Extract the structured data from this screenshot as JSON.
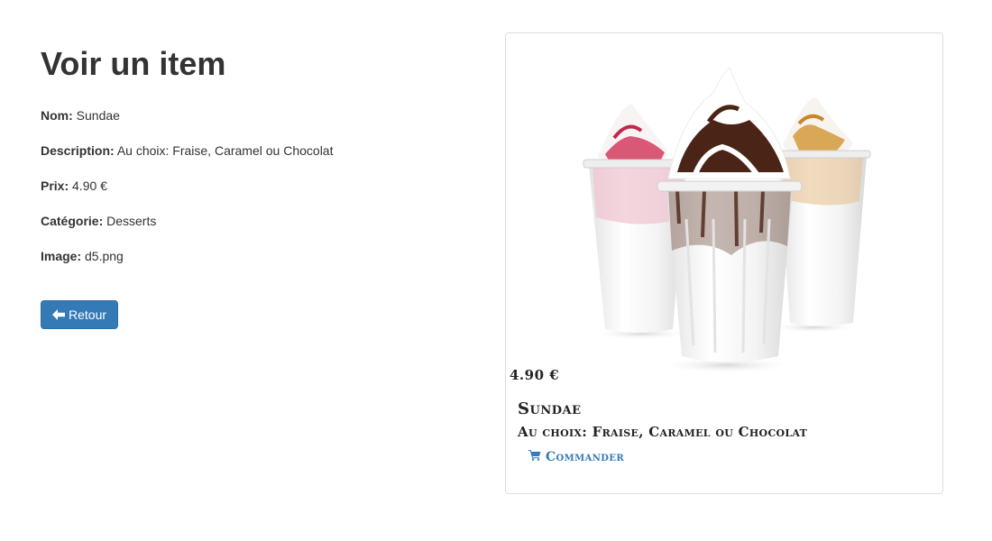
{
  "page": {
    "title": "Voir un item"
  },
  "details": {
    "name_label": "Nom:",
    "name_value": "Sundae",
    "description_label": "Description:",
    "description_value": "Au choix: Fraise, Caramel ou Chocolat",
    "price_label": "Prix:",
    "price_value": "4.90 €",
    "category_label": "Catégorie:",
    "category_value": "Desserts",
    "image_label": "Image:",
    "image_value": "d5.png"
  },
  "back_button": {
    "label": "Retour",
    "icon": "arrow-left-icon"
  },
  "card": {
    "price": "4.90 €",
    "name": "Sundae",
    "description": "Au choix: Fraise, Caramel ou Chocolat",
    "order_label": "Commander",
    "order_icon": "shopping-cart-icon"
  },
  "colors": {
    "primary": "#337ab7",
    "text": "#333333",
    "card_border": "#dddddd"
  }
}
